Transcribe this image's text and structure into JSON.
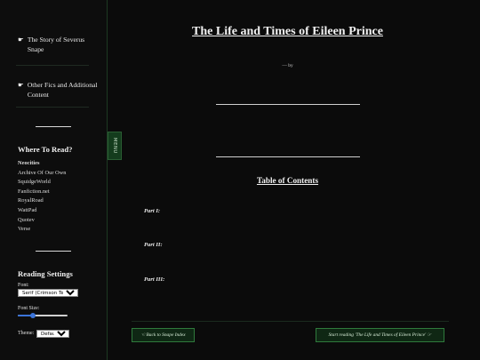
{
  "sidebar": {
    "links": [
      {
        "glyph": "☛",
        "label": "The Story of Severus Snape"
      },
      {
        "glyph": "☛",
        "label": "Other Fics and Additional Content"
      }
    ],
    "where_to_read": {
      "heading": "Where To Read?",
      "sites": [
        "Neocities",
        "Archive Of Our Own",
        "SquidgeWorld",
        "Fanfiction.net",
        "RoyalRoad",
        "WattPad",
        "Quotev",
        "Verse"
      ]
    },
    "reading_settings": {
      "heading": "Reading Settings",
      "font_label": "Font:",
      "font_value": "Serif (Crimson Text)",
      "font_size_label": "Font Size:",
      "font_size_fraction": 0.3,
      "theme_label": "Theme:",
      "theme_value": "Default"
    }
  },
  "menu_tab": {
    "label": "MENU"
  },
  "main": {
    "title": "The Life and Times of Eileen Prince",
    "byline": "— by",
    "toc_title": "Table of Contents",
    "parts": [
      "Part I:",
      "Part II:",
      "Part III:"
    ],
    "back_button": "☜ Back to Snape Index",
    "start_button": "Start reading 'The Life and Times of Eileen Prince' ☞"
  }
}
